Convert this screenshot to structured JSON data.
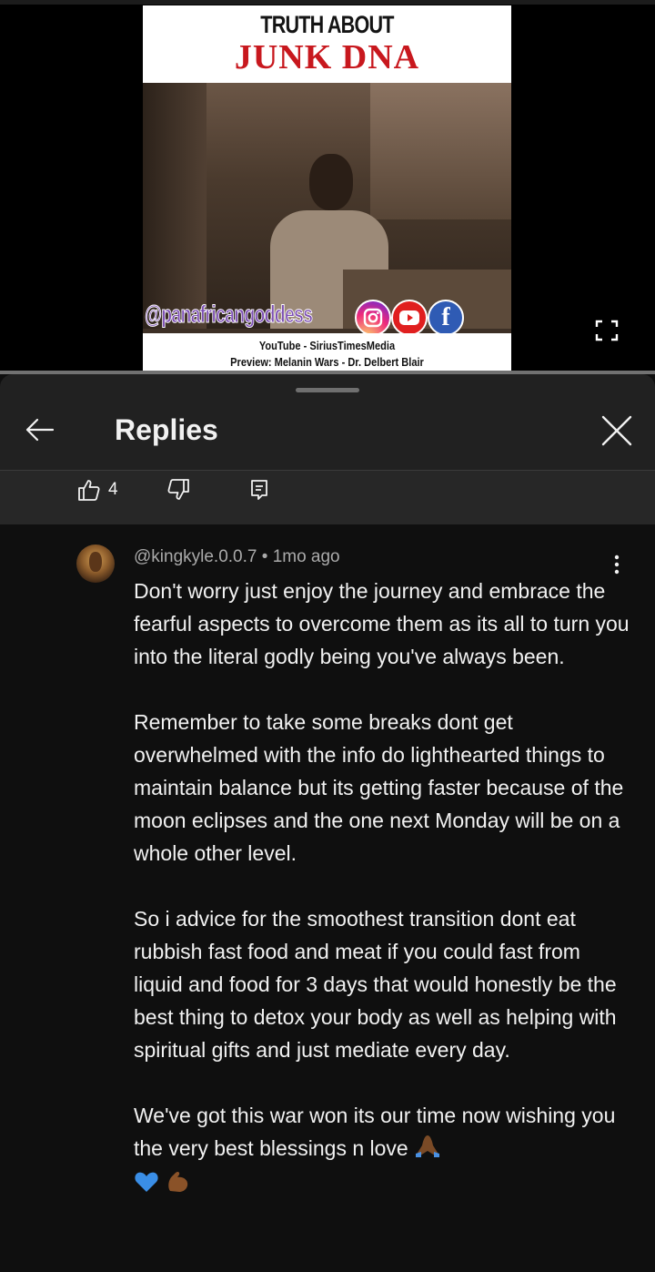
{
  "video": {
    "title_line1": "TRUTH ABOUT",
    "title_line2": "JUNK DNA",
    "handle": "@panafricangoddess",
    "social_icons": [
      "instagram-icon",
      "youtube-icon",
      "facebook-icon"
    ],
    "facebook_glyph": "f",
    "footer_line1": "YouTube - SiriusTimesMedia",
    "footer_line2": "Preview: Melanin Wars - Dr. Delbert Blair",
    "title_color": "#c8181e",
    "handle_color": "#7d4fb4"
  },
  "replies_panel": {
    "title": "Replies",
    "parent_comment": {
      "like_count": "4"
    },
    "reply": {
      "author": "@kingkyle.0.0.7",
      "separator": "•",
      "time": "1mo ago",
      "paragraphs": [
        "Don't worry just enjoy the journey and embrace the fearful aspects to overcome them as its all to turn you into the literal godly being you've always been.",
        "Remember to take some breaks dont get overwhelmed with the info do lighthearted things to maintain balance but its getting faster because of the moon eclipses and the one next Monday will be on a whole other level.",
        "So i advice for the smoothest transition dont eat rubbish fast food and meat if you could fast from liquid and food for 3 days that would honestly be the best thing to detox your body as well as helping with spiritual gifts and just mediate every day."
      ],
      "last_paragraph": "We've got this war won its our time now wishing you the very best blessings n love",
      "trailing_emojis": [
        "folded-hands-emoji",
        "blue-heart-emoji",
        "flexed-biceps-emoji"
      ]
    }
  },
  "colors": {
    "background": "#0f0f0f",
    "sheet": "#212121",
    "action_bar": "#272727",
    "text_primary": "#f1f1f1",
    "text_secondary": "#aaaaaa"
  }
}
